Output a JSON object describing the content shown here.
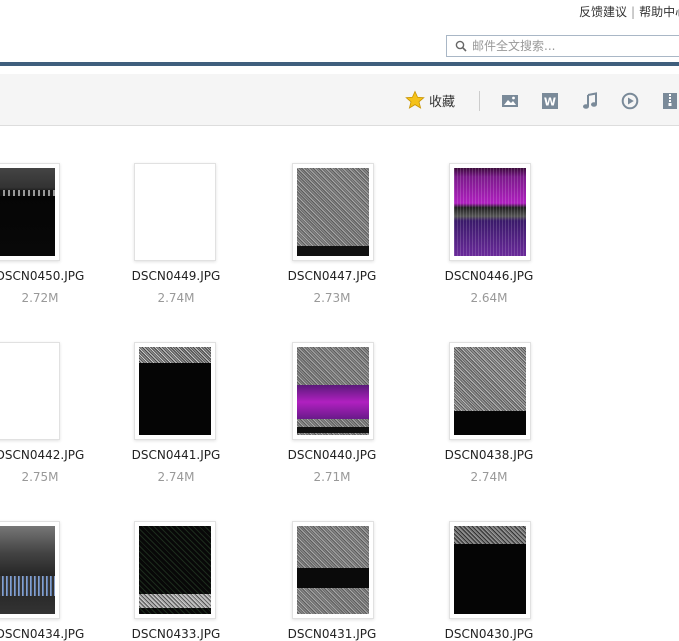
{
  "header": {
    "links": [
      "反馈建议",
      "帮助中心"
    ],
    "search_placeholder": "邮件全文搜索..."
  },
  "toolbar": {
    "favorite_label": "收藏",
    "icons": [
      "image-icon",
      "word-doc-icon",
      "music-icon",
      "video-play-icon",
      "archive-icon"
    ]
  },
  "files": [
    {
      "name": "DSCN0450.JPG",
      "size": "2.72M"
    },
    {
      "name": "DSCN0449.JPG",
      "size": "2.74M"
    },
    {
      "name": "DSCN0447.JPG",
      "size": "2.73M"
    },
    {
      "name": "DSCN0446.JPG",
      "size": "2.64M"
    },
    {
      "name": "DSCN0442.JPG",
      "size": "2.75M"
    },
    {
      "name": "DSCN0441.JPG",
      "size": "2.74M"
    },
    {
      "name": "DSCN0440.JPG",
      "size": "2.71M"
    },
    {
      "name": "DSCN0438.JPG",
      "size": "2.74M"
    },
    {
      "name": "DSCN0434.JPG",
      "size": ""
    },
    {
      "name": "DSCN0433.JPG",
      "size": ""
    },
    {
      "name": "DSCN0431.JPG",
      "size": ""
    },
    {
      "name": "DSCN0430.JPG",
      "size": ""
    }
  ],
  "colors": {
    "accent_band": "#3f5f7d",
    "star": "#f5b800",
    "toolbar_icon": "#7a8a99"
  }
}
